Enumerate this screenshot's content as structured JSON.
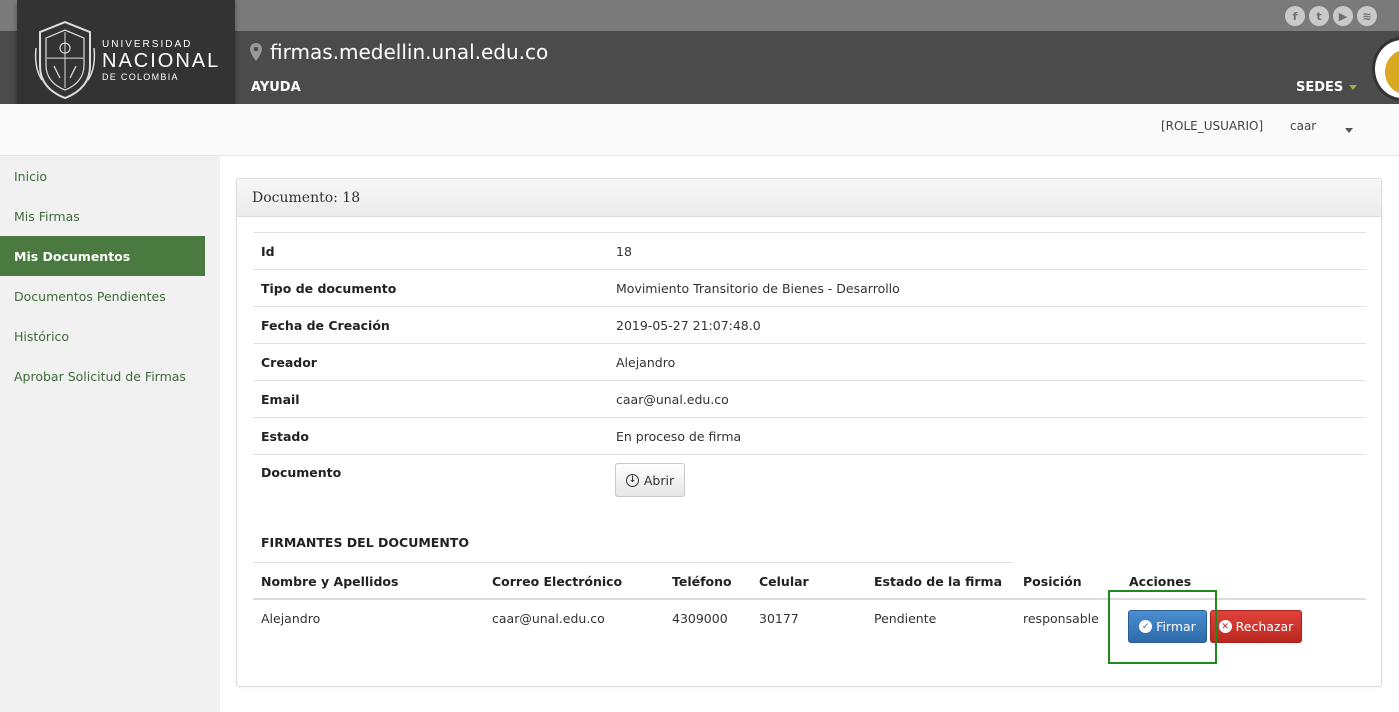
{
  "header": {
    "logo": {
      "line1": "UNIVERSIDAD",
      "line2": "NACIONAL",
      "line3": "DE COLOMBIA"
    },
    "site_url": "firmas.medellin.unal.edu.co",
    "help_label": "AYUDA",
    "sedes_label": "SEDES",
    "social_icons": [
      "facebook-icon",
      "twitter-icon",
      "youtube-icon",
      "rss-icon"
    ],
    "social_glyphs": {
      "facebook": "f",
      "twitter": "t",
      "youtube": "▶",
      "rss": "≋"
    }
  },
  "userbar": {
    "role": "[ROLE_USUARIO]",
    "user": "caar"
  },
  "sidebar": {
    "items": [
      {
        "label": "Inicio",
        "active": false
      },
      {
        "label": "Mis Firmas",
        "active": false
      },
      {
        "label": "Mis Documentos",
        "active": true
      },
      {
        "label": "Documentos Pendientes",
        "active": false
      },
      {
        "label": "Histórico",
        "active": false
      },
      {
        "label": "Aprobar Solicitud de Firmas",
        "active": false
      }
    ]
  },
  "document": {
    "title": "Documento: 18",
    "fields": [
      {
        "label": "Id",
        "value": "18"
      },
      {
        "label": "Tipo de documento",
        "value": "Movimiento Transitorio de Bienes - Desarrollo"
      },
      {
        "label": "Fecha de Creación",
        "value": "2019-05-27 21:07:48.0"
      },
      {
        "label": "Creador",
        "value": "Alejandro"
      },
      {
        "label": "Email",
        "value": "caar@unal.edu.co"
      },
      {
        "label": "Estado",
        "value": "En proceso de firma"
      },
      {
        "label": "Documento",
        "value": ""
      }
    ],
    "open_button": "Abrir"
  },
  "signers": {
    "title": "FIRMANTES DEL DOCUMENTO",
    "columns": [
      "Nombre y Apellidos",
      "Correo Electrónico",
      "Teléfono",
      "Celular",
      "Estado de la firma",
      "Posición",
      "Acciones"
    ],
    "rows": [
      {
        "nombre": "Alejandro",
        "correo": "caar@unal.edu.co",
        "telefono": "4309000",
        "celular": "30177",
        "estado": "Pendiente",
        "posicion": "responsable"
      }
    ],
    "sign_button": "Firmar",
    "reject_button": "Rechazar"
  },
  "colors": {
    "header_dark": "#4b4b4b",
    "active_nav": "#4a7a3f",
    "sign_blue": "#2d6aa8",
    "reject_red": "#c02a22",
    "highlight_green": "#1c8a1c"
  }
}
